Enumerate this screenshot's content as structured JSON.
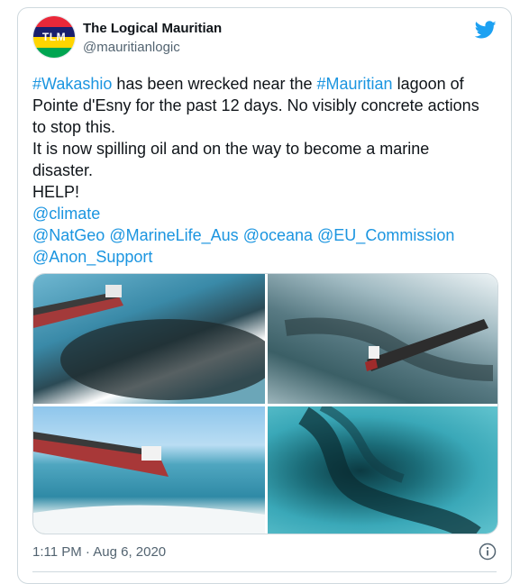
{
  "account": {
    "display_name": "The Logical Mauritian",
    "handle": "@mauritianlogic",
    "avatar_text": "TLM",
    "avatar_colors": [
      "#ea2839",
      "#1a206d",
      "#ffd500",
      "#00a551"
    ]
  },
  "tweet": {
    "line1_tag1": "#Wakashio",
    "line1_mid": " has been wrecked near the ",
    "line1_tag2": "#Mauritian",
    "line1_end": " lagoon of\nPointe d'Esny for the past 12 days. No visibly concrete actions\nto stop this.\nIt is now spilling oil and on the way to become a marine\ndisaster.\nHELP!\n",
    "mention_climate": "@climate",
    "mention_natgeo": "@NatGeo",
    "mention_marinelife": "@MarineLife_Aus",
    "mention_oceana": "@oceana",
    "mention_eu": "@EU_Commission",
    "mention_anon": "@Anon_Support"
  },
  "timestamp": "1:11 PM · Aug 6, 2020",
  "icons": {
    "platform": "twitter-bird-icon",
    "info": "info-icon"
  },
  "colors": {
    "link": "#1b95e0",
    "brand": "#1da1f2"
  }
}
